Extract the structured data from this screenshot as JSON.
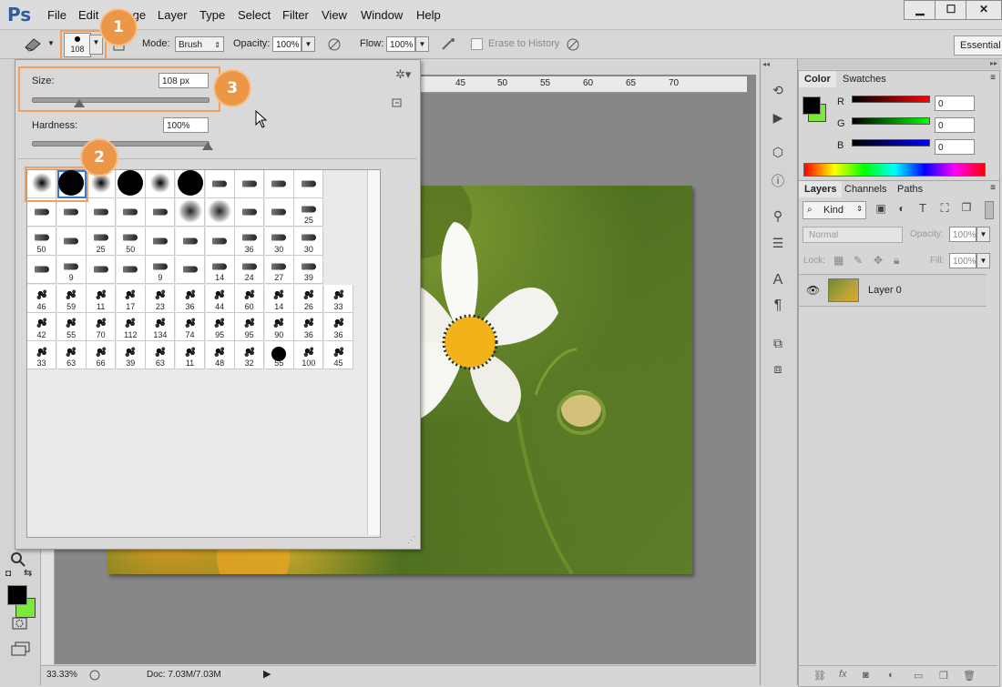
{
  "app": {
    "logo": "Ps"
  },
  "menu": [
    "File",
    "Edit",
    "Image",
    "Layer",
    "Type",
    "Select",
    "Filter",
    "View",
    "Window",
    "Help"
  ],
  "window_controls": {
    "minimize": "▁",
    "maximize": "☐",
    "close": "✕"
  },
  "options": {
    "brush_size_preview": "108",
    "mode_label": "Mode:",
    "mode_value": "Brush",
    "opacity_label": "Opacity:",
    "opacity_value": "100%",
    "flow_label": "Flow:",
    "flow_value": "100%",
    "erase_to_history": "Erase to History",
    "workspace": "Essential"
  },
  "callouts": [
    "1",
    "2",
    "3"
  ],
  "brush_popup": {
    "size_label": "Size:",
    "size_value": "108 px",
    "size_fraction": 0.27,
    "hardness_label": "Hardness:",
    "hardness_value": "100%",
    "hardness_fraction": 1.0
  },
  "presets": [
    [
      "",
      "",
      "",
      "",
      "",
      "",
      "",
      "",
      "",
      ""
    ],
    [
      "",
      "",
      "",
      "",
      "",
      "",
      "",
      "",
      "",
      "25"
    ],
    [
      "50",
      "",
      "25",
      "50",
      "",
      "",
      "",
      "36",
      "30",
      "30"
    ],
    [
      "",
      "9",
      "",
      "",
      "9",
      "",
      "14",
      "24",
      "27",
      "39"
    ],
    [
      "46",
      "59",
      "11",
      "17",
      "23",
      "36",
      "44",
      "60",
      "14",
      "26",
      "33"
    ],
    [
      "42",
      "55",
      "70",
      "112",
      "134",
      "74",
      "95",
      "95",
      "90",
      "36",
      "36"
    ],
    [
      "33",
      "63",
      "66",
      "39",
      "63",
      "11",
      "48",
      "32",
      "55",
      "100",
      "45"
    ]
  ],
  "ruler": [
    "45",
    "50",
    "55",
    "60",
    "65",
    "70"
  ],
  "status": {
    "zoom": "33.33%",
    "doc": "Doc: 7.03M/7.03M"
  },
  "color_panel": {
    "tabs": [
      "Color",
      "Swatches"
    ],
    "r_label": "R",
    "r_value": "0",
    "g_label": "G",
    "g_value": "0",
    "b_label": "B",
    "b_value": "0",
    "fg": "#000000",
    "bg": "#7ce83a"
  },
  "layers_panel": {
    "tabs": [
      "Layers",
      "Channels",
      "Paths"
    ],
    "kind": "Kind",
    "blend_mode": "Normal",
    "opacity_label": "Opacity:",
    "opacity_value": "100%",
    "lock_label": "Lock:",
    "fill_label": "Fill:",
    "fill_value": "100%",
    "layer_name": "Layer 0"
  }
}
